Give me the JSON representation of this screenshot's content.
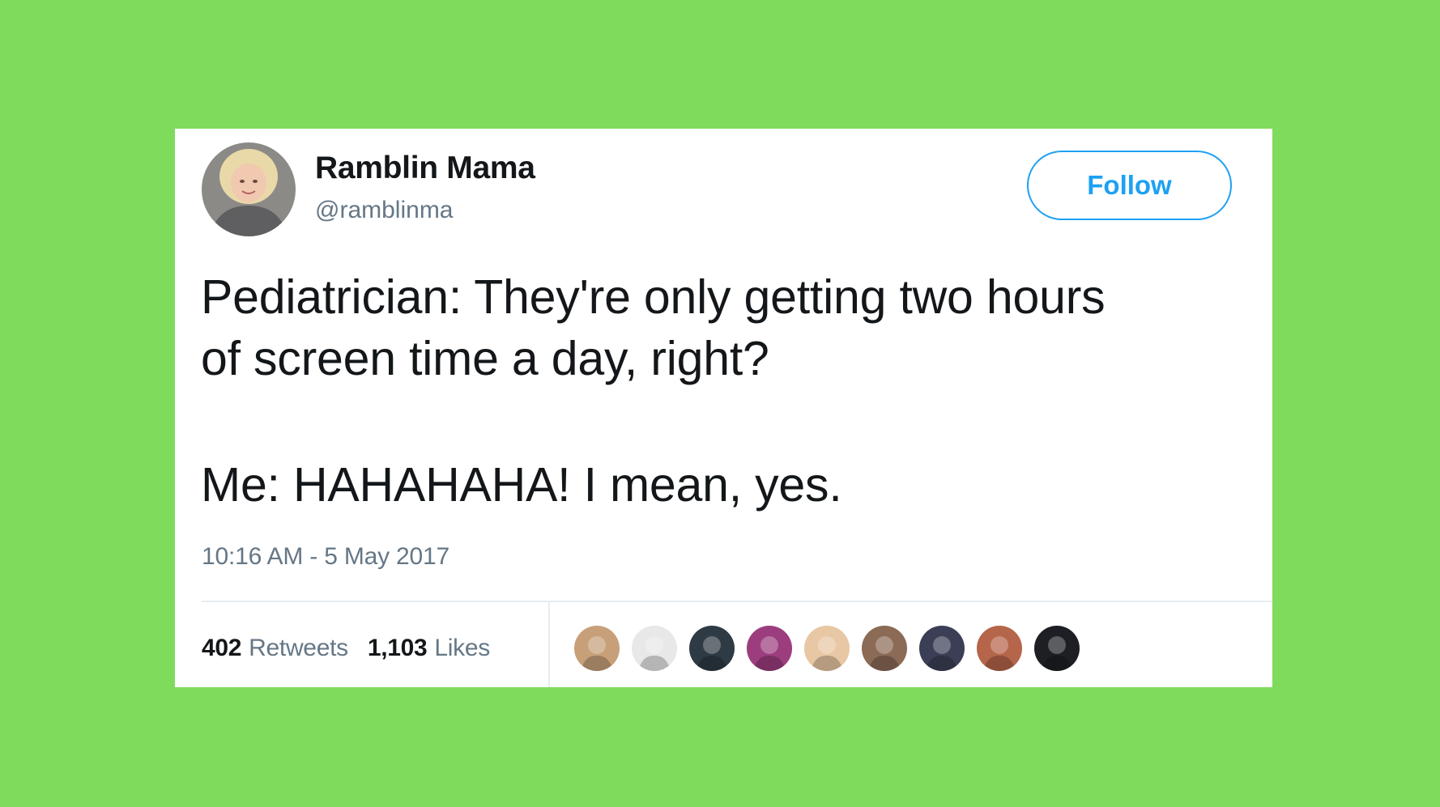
{
  "tweet": {
    "author": {
      "display_name": "Ramblin Mama",
      "handle": "@ramblinma",
      "avatar_icon": "profile-photo-icon"
    },
    "follow_label": "Follow",
    "text_line_1": "Pediatrician: They're only getting two hours\nof screen time a day, right?",
    "text_line_2": "Me: HAHAHAHA! I mean, yes.",
    "timestamp": "10:16 AM - 5 May 2017",
    "retweets_count": "402",
    "retweets_label": "Retweets",
    "likes_count": "1,103",
    "likes_label": "Likes",
    "likers": [
      {
        "icon": "liker-avatar-icon",
        "color": "#c7a07a"
      },
      {
        "icon": "liker-avatar-icon",
        "color": "#e8e8e8"
      },
      {
        "icon": "liker-avatar-icon",
        "color": "#2e3a44"
      },
      {
        "icon": "liker-avatar-icon",
        "color": "#9c3d7e"
      },
      {
        "icon": "liker-avatar-icon",
        "color": "#e8c7a4"
      },
      {
        "icon": "liker-avatar-icon",
        "color": "#8b6a56"
      },
      {
        "icon": "liker-avatar-icon",
        "color": "#3a3f55"
      },
      {
        "icon": "liker-avatar-icon",
        "color": "#b5654a"
      },
      {
        "icon": "liker-avatar-icon",
        "color": "#1d1f24"
      }
    ]
  },
  "colors": {
    "background": "#7fdb5c",
    "accent": "#1da1f2",
    "text": "#14171a",
    "muted": "#657786"
  }
}
